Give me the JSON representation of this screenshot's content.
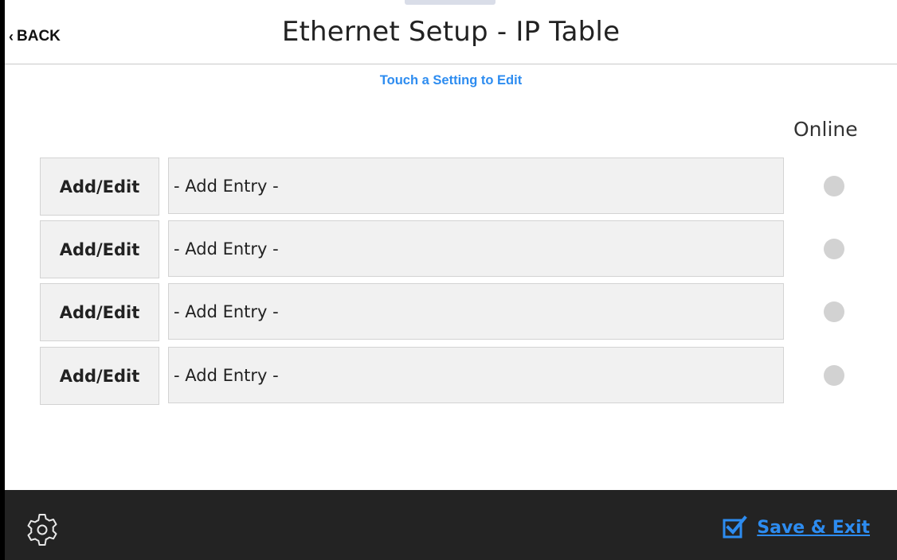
{
  "header": {
    "back_label": "BACK",
    "title": "Ethernet Setup - IP Table"
  },
  "hint": "Touch a Setting to Edit",
  "online_header": "Online",
  "rows": [
    {
      "button_label": "Add/Edit",
      "entry_text": "- Add Entry -"
    },
    {
      "button_label": "Add/Edit",
      "entry_text": "- Add Entry -"
    },
    {
      "button_label": "Add/Edit",
      "entry_text": "- Add Entry -"
    },
    {
      "button_label": "Add/Edit",
      "entry_text": "- Add Entry -"
    }
  ],
  "footer": {
    "settings_icon": "gear-icon",
    "save_exit_label": "Save & Exit",
    "save_icon": "checkbox-checked-icon"
  },
  "colors": {
    "accent": "#2d8cf0",
    "footer_bg": "#232323",
    "status_offline": "#d2d2d2"
  }
}
